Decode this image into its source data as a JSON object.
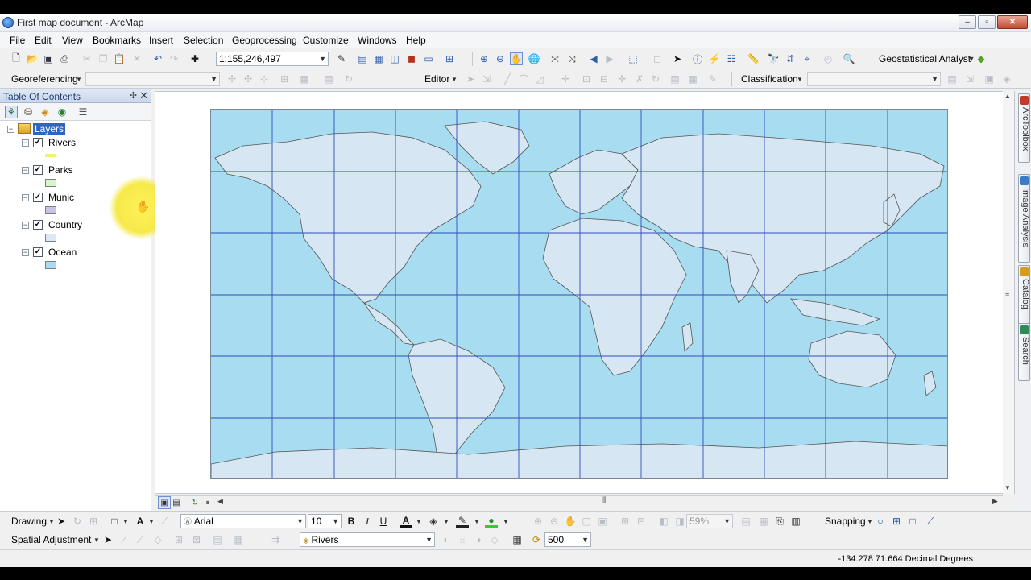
{
  "window": {
    "title": "First map document - ArcMap"
  },
  "menu": [
    "File",
    "Edit",
    "View",
    "Bookmarks",
    "Insert",
    "Selection",
    "Geoprocessing",
    "Customize",
    "Windows",
    "Help"
  ],
  "toolbar": {
    "scale_value": "1:155,246,497",
    "geostatistical_label": "Geostatistical Analyst",
    "georeferencing_label": "Georeferencing",
    "editor_label": "Editor",
    "classification_label": "Classification"
  },
  "toc": {
    "title": "Table Of Contents",
    "root_label": "Layers",
    "layers": [
      {
        "label": "Rivers",
        "checked": true,
        "swatch_color": "#f0f07a",
        "swatch_kind": "line"
      },
      {
        "label": "Parks",
        "checked": true,
        "swatch_color": "#d6f5c8",
        "swatch_kind": "fill"
      },
      {
        "label": "Munic",
        "checked": true,
        "swatch_color": "#c9c1e6",
        "swatch_kind": "fill"
      },
      {
        "label": "Country",
        "checked": true,
        "swatch_color": "#dbe7f2",
        "swatch_kind": "fill"
      },
      {
        "label": "Ocean",
        "checked": true,
        "swatch_color": "#a8dcf0",
        "swatch_kind": "fill"
      }
    ]
  },
  "map": {
    "ocean_color": "#a8dcf0",
    "land_color": "#d7e6f3",
    "graticule_color": "#2e4fb8"
  },
  "side_tabs": [
    "ArcToolbox",
    "Image Analysis",
    "Catalog",
    "Search"
  ],
  "drawing_toolbar": {
    "drawing_label": "Drawing",
    "font_name": "Arial",
    "font_size": "10",
    "zoom_percent": "59%",
    "snapping_label": "Snapping"
  },
  "spatial_toolbar": {
    "label": "Spatial Adjustment",
    "layer_value": "Rivers",
    "number_value": "500"
  },
  "status": {
    "coordinates": "-134.278  71.664 Decimal Degrees"
  },
  "icons": {
    "new": "new-document-icon",
    "open": "open-icon",
    "save": "save-icon",
    "print": "print-icon",
    "undo": "undo-icon",
    "redo": "redo-icon",
    "add_data": "add-data-icon",
    "zoom_in": "zoom-in-icon",
    "zoom_out": "zoom-out-icon",
    "pan": "pan-icon",
    "globe": "full-extent-icon",
    "identify": "identify-icon",
    "select": "select-arrow-icon"
  }
}
